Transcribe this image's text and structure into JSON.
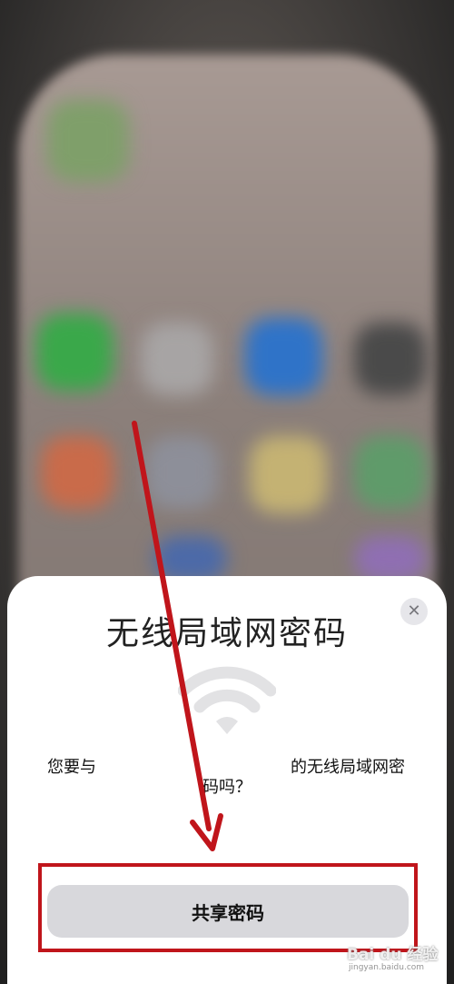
{
  "sheet": {
    "title": "无线局域网密码",
    "message_part1": "您要与",
    "message_part2": "的无线局域网密",
    "message_part3": "码吗？",
    "share_label": "共享密码",
    "close_symbol": "✕"
  },
  "watermark": {
    "brand": "Bai du 经验",
    "url": "jingyan.baidu.com"
  },
  "icons": [
    "wifi-icon",
    "close-icon"
  ],
  "colors": {
    "annotation_red": "#c0151b",
    "button_gray": "#d8d8dc"
  }
}
